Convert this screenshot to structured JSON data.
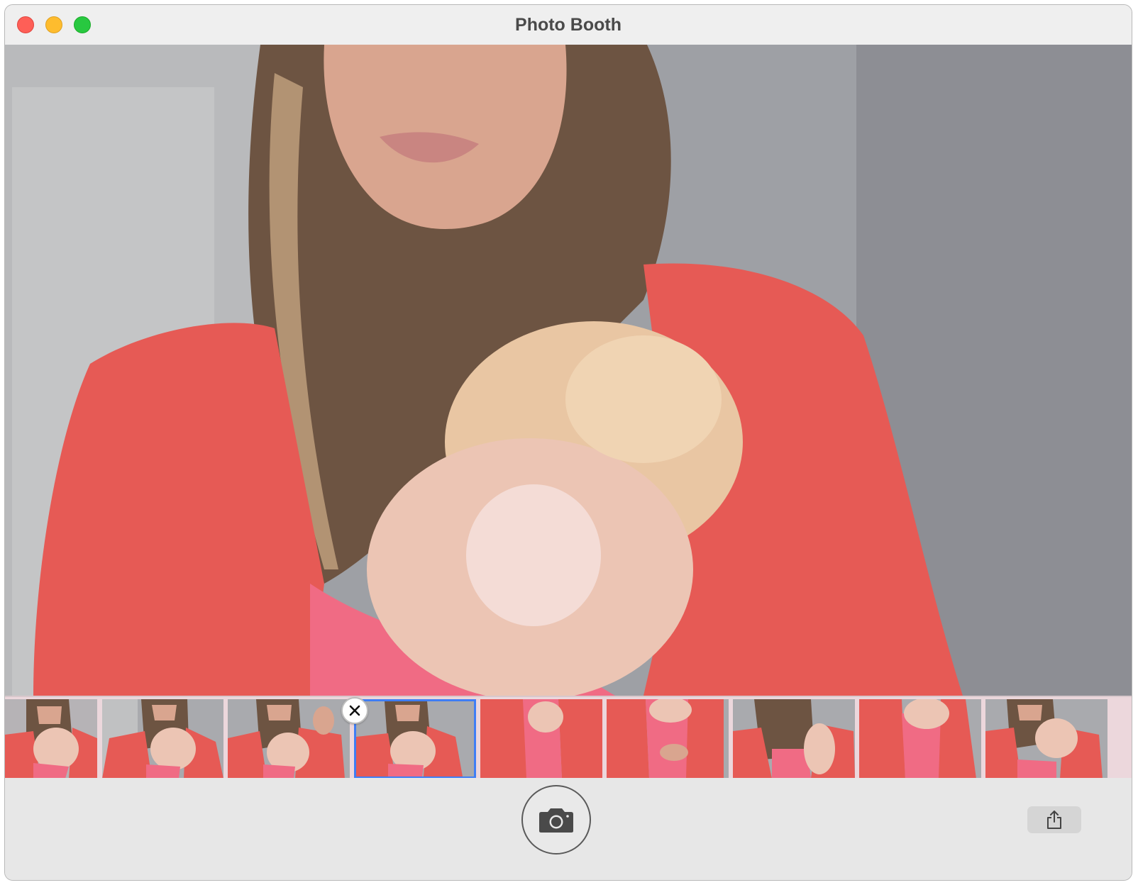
{
  "window": {
    "title": "Photo Booth"
  },
  "traffic_lights": {
    "close": "close-window",
    "minimize": "minimize-window",
    "zoom": "zoom-window"
  },
  "colors": {
    "jacket": "#e85a5a",
    "shirt": "#f06a85",
    "wall": "#9fa0a5",
    "selection": "#3f7ef5"
  },
  "filmstrip": {
    "thumbnail_count": 9,
    "selected_index": 3
  },
  "icons": {
    "delete": "close-x-icon",
    "shutter": "camera-icon",
    "share": "share-icon"
  }
}
